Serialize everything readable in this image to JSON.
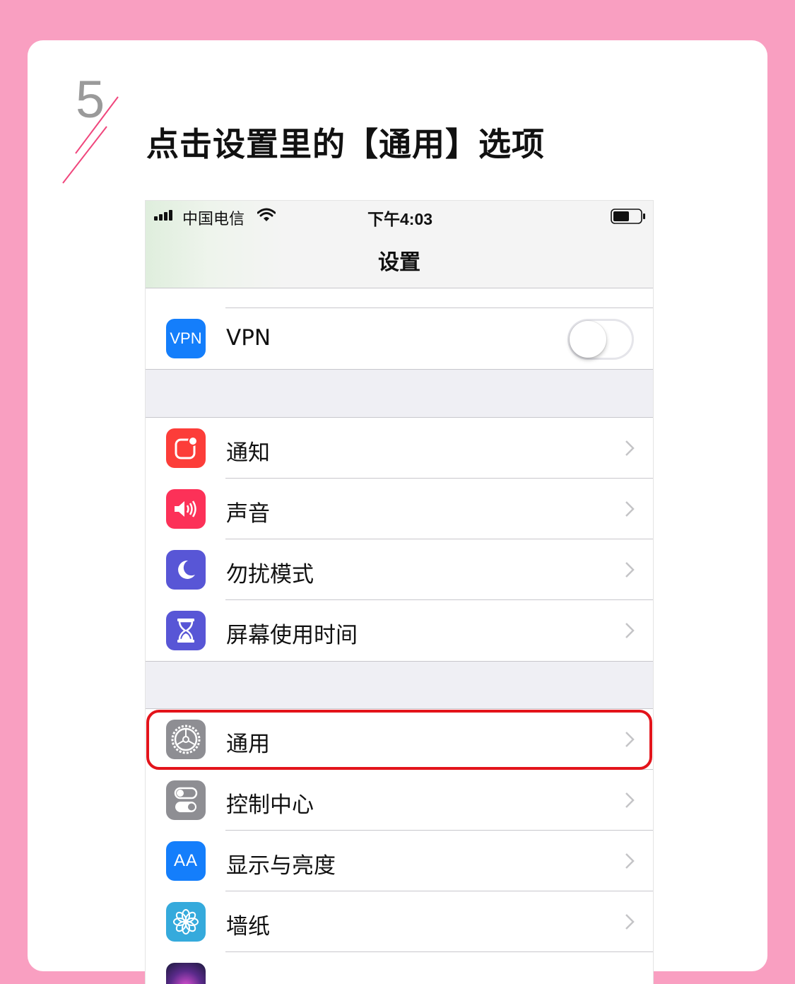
{
  "step": {
    "number": "5",
    "title": "点击设置里的【通用】选项"
  },
  "status_bar": {
    "carrier": "中国电信",
    "time": "下午4:03"
  },
  "nav": {
    "title": "设置"
  },
  "vpn_row": {
    "icon_text": "VPN",
    "label": "VPN",
    "toggle_on": false
  },
  "group_notifications": [
    {
      "label": "通知",
      "icon": "notifications-icon",
      "color": "#fc3d39"
    },
    {
      "label": "声音",
      "icon": "sound-icon",
      "color": "#fc3158"
    },
    {
      "label": "勿扰模式",
      "icon": "moon-icon",
      "color": "#5856d6"
    },
    {
      "label": "屏幕使用时间",
      "icon": "hourglass-icon",
      "color": "#5856d6"
    }
  ],
  "group_general": [
    {
      "label": "通用",
      "icon": "gear-icon",
      "color": "#8e8e93",
      "highlighted": true
    },
    {
      "label": "控制中心",
      "icon": "switches-icon",
      "color": "#8e8e93"
    },
    {
      "label": "显示与亮度",
      "icon": "text-size-icon",
      "color": "#147efb",
      "icon_text": "AA"
    },
    {
      "label": "墙纸",
      "icon": "flower-icon",
      "color": "#35aadc"
    }
  ],
  "colors": {
    "background": "#f99fc1",
    "highlight": "#e3141b",
    "vpn_blue": "#147efb"
  }
}
